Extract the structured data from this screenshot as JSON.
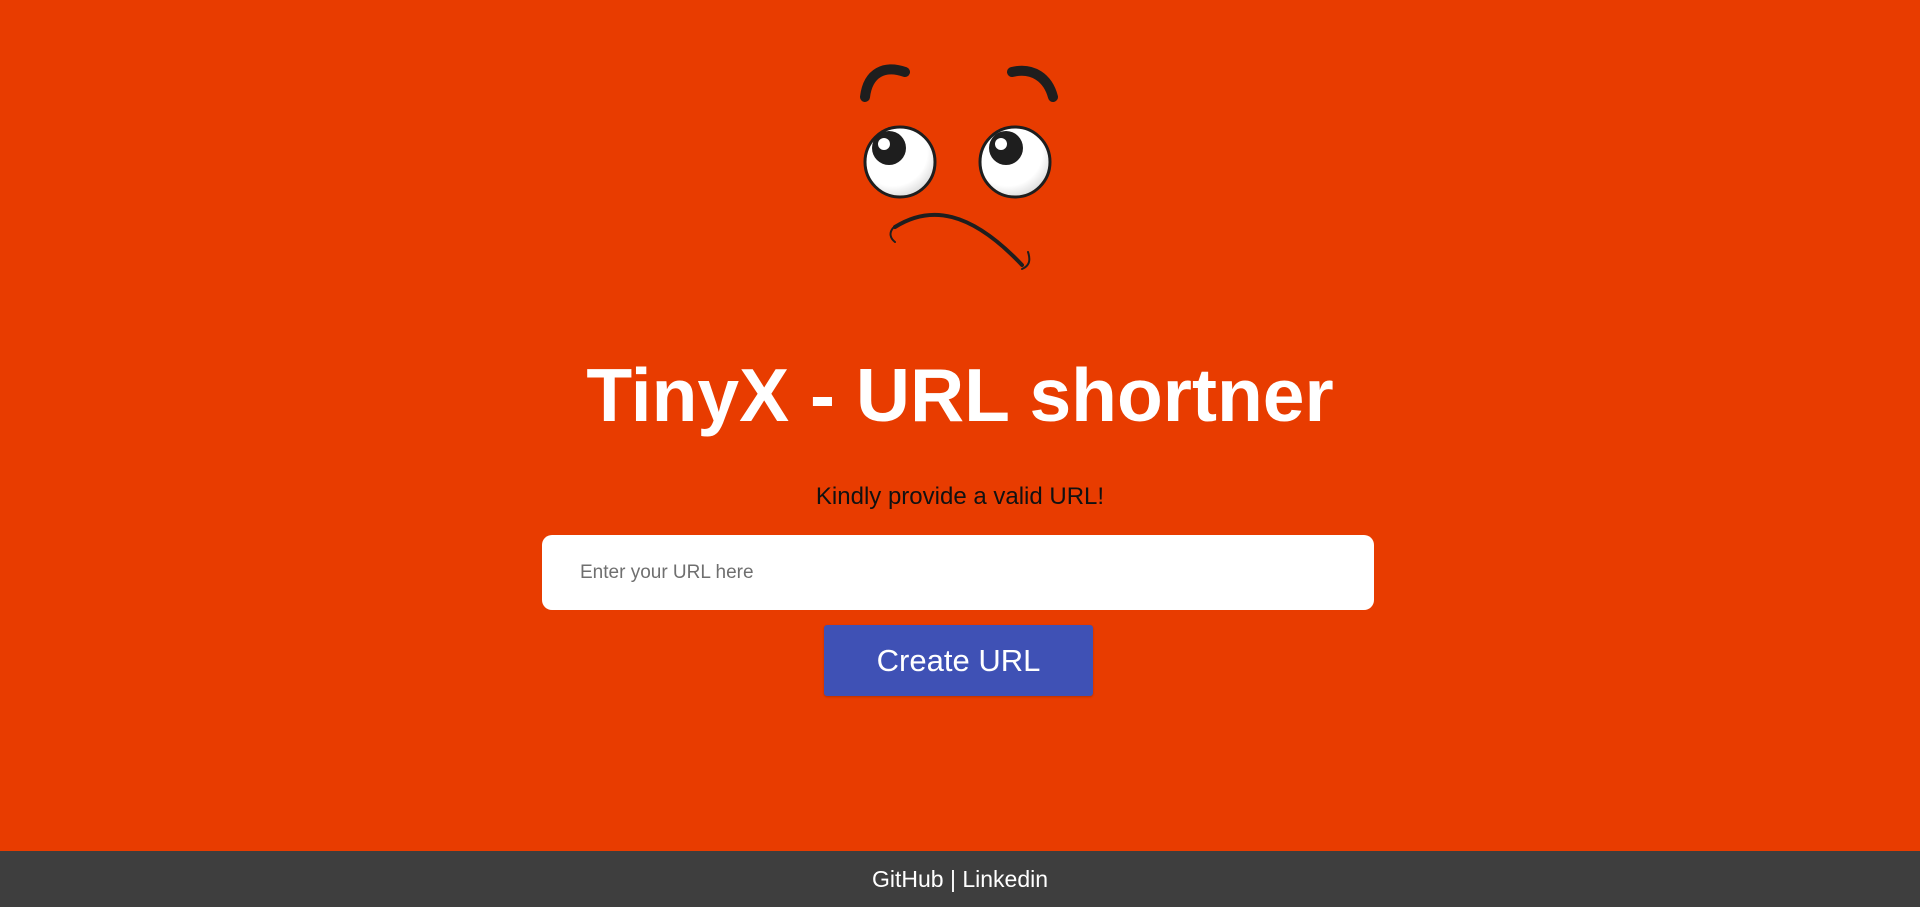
{
  "page": {
    "background_color": "#e83c00"
  },
  "hero": {
    "illustration": "sad-face-icon",
    "title": "TinyX - URL shortner",
    "subtitle": "Kindly provide a valid URL!"
  },
  "form": {
    "url_input": {
      "value": "",
      "placeholder": "Enter your URL here"
    },
    "submit_label": "Create URL",
    "submit_color": "#3f51b5"
  },
  "footer": {
    "background_color": "#3e3e3e",
    "links": [
      {
        "label": "GitHub"
      },
      {
        "label": "Linkedin"
      }
    ],
    "separator": "|"
  }
}
